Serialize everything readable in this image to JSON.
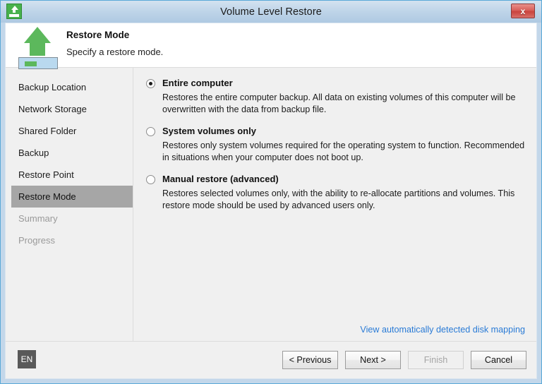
{
  "window": {
    "title": "Volume Level Restore",
    "app_icon": "green-up-arrow-icon",
    "close_label": "x"
  },
  "header": {
    "icon": "green-up-arrow-restore-icon",
    "title": "Restore Mode",
    "subtitle": "Specify a restore mode."
  },
  "sidebar": {
    "items": [
      {
        "label": "Backup Location",
        "state": "normal"
      },
      {
        "label": "Network Storage",
        "state": "normal"
      },
      {
        "label": "Shared Folder",
        "state": "normal"
      },
      {
        "label": "Backup",
        "state": "normal"
      },
      {
        "label": "Restore Point",
        "state": "normal"
      },
      {
        "label": "Restore Mode",
        "state": "selected"
      },
      {
        "label": "Summary",
        "state": "disabled"
      },
      {
        "label": "Progress",
        "state": "disabled"
      }
    ]
  },
  "content": {
    "options": [
      {
        "label": "Entire computer",
        "description": "Restores the entire computer backup. All data on existing volumes of this computer will be overwritten with the data from backup file.",
        "selected": true
      },
      {
        "label": "System volumes only",
        "description": "Restores only system volumes required for the operating system to function. Recommended in situations when your computer does not boot up.",
        "selected": false
      },
      {
        "label": "Manual restore (advanced)",
        "description": "Restores selected volumes only, with the ability to re-allocate partitions and volumes. This restore mode should be used by advanced users only.",
        "selected": false
      }
    ],
    "link": "View automatically detected disk mapping"
  },
  "footer": {
    "language": "EN",
    "buttons": [
      {
        "label": "< Previous",
        "disabled": false
      },
      {
        "label": "Next >",
        "disabled": false
      },
      {
        "label": "Finish",
        "disabled": true
      },
      {
        "label": "Cancel",
        "disabled": false
      }
    ]
  },
  "colors": {
    "accent_link": "#2a7bd6",
    "selected_nav": "#a6a6a6",
    "icon_green": "#5cb85c",
    "close_red": "#c9433d"
  }
}
